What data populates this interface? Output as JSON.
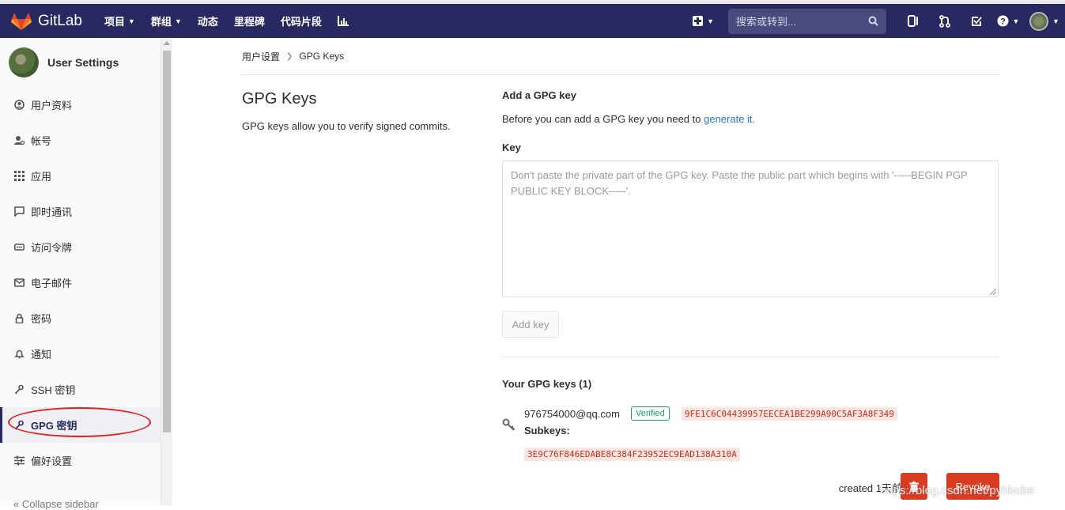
{
  "topbar": {
    "brand": "GitLab",
    "nav": [
      {
        "label": "项目",
        "dropdown": true
      },
      {
        "label": "群组",
        "dropdown": true
      },
      {
        "label": "动态",
        "dropdown": false
      },
      {
        "label": "里程碑",
        "dropdown": false
      },
      {
        "label": "代码片段",
        "dropdown": false
      }
    ],
    "search_placeholder": "搜索或转到...",
    "icons": [
      "plus-icon",
      "search-icon",
      "issues-icon",
      "merge-request-icon",
      "todo-icon",
      "help-icon",
      "avatar"
    ],
    "bg_color": "#292961"
  },
  "sidebar": {
    "title": "User Settings",
    "items": [
      {
        "label": "用户资料",
        "icon": "profile-icon"
      },
      {
        "label": "帐号",
        "icon": "account-icon"
      },
      {
        "label": "应用",
        "icon": "applications-icon"
      },
      {
        "label": "即时通讯",
        "icon": "chat-icon"
      },
      {
        "label": "访问令牌",
        "icon": "token-icon"
      },
      {
        "label": "电子邮件",
        "icon": "email-icon"
      },
      {
        "label": "密码",
        "icon": "lock-icon"
      },
      {
        "label": "通知",
        "icon": "bell-icon"
      },
      {
        "label": "SSH 密钥",
        "icon": "key-icon"
      },
      {
        "label": "GPG 密钥",
        "icon": "key-icon",
        "active": true
      },
      {
        "label": "偏好设置",
        "icon": "preferences-icon"
      }
    ],
    "collapse_label": "Collapse sidebar"
  },
  "breadcrumb": {
    "parent": "用户设置",
    "current": "GPG Keys"
  },
  "main": {
    "title": "GPG Keys",
    "description": "GPG keys allow you to verify signed commits.",
    "add_section_title": "Add a GPG key",
    "before_text": "Before you can add a GPG key you need to ",
    "generate_link": "generate it.",
    "key_label": "Key",
    "key_placeholder": "Don't paste the private part of the GPG key. Paste the public part which begins with '-----BEGIN PGP PUBLIC KEY BLOCK-----'.",
    "add_button": "Add key",
    "your_keys_title": "Your GPG keys (1)",
    "key": {
      "email": "976754000@qq.com",
      "status": "Verified",
      "fingerprint": "9FE1C6C04439957EECEA1BE299A90C5AF3A8F349",
      "subkeys_label": "Subkeys:",
      "subkey": "3E9C76F846EDABE8C384F23952EC9EAD138A310A",
      "created": "created 1天前"
    },
    "revoke_button": "Revoke"
  },
  "watermark": "https://blog.csdn.net/pyhkobe"
}
